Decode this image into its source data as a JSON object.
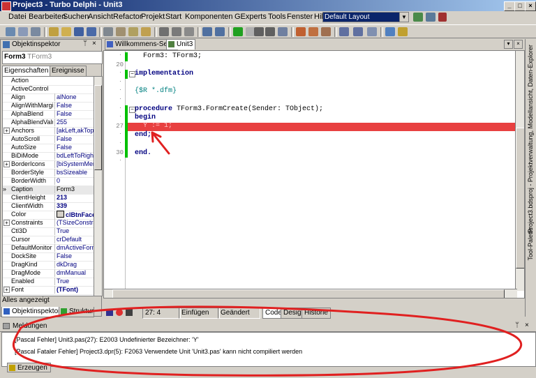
{
  "window": {
    "title": "Project3 - Turbo Delphi - Unit3",
    "buttons": [
      "_",
      "□",
      "×"
    ]
  },
  "menu": [
    "Datei",
    "Bearbeiten",
    "Suchen",
    "Ansicht",
    "Refactor",
    "Projekt",
    "Start",
    "Komponenten",
    "GExperts",
    "Tools",
    "Fenster",
    "Hilfe"
  ],
  "layout_selector": {
    "value": "Default Layout"
  },
  "object_inspector": {
    "title": "Objektinspektor",
    "pin": "ᛘ",
    "close": "×",
    "selected_object": "Form3",
    "selected_type": "TForm3",
    "tabs": [
      "Eigenschaften",
      "Ereignisse"
    ],
    "status": "Alles angezeigt",
    "properties": [
      {
        "name": "Action",
        "value": ""
      },
      {
        "name": "ActiveControl",
        "value": ""
      },
      {
        "name": "Align",
        "value": "alNone"
      },
      {
        "name": "AlignWithMargins",
        "value": "False"
      },
      {
        "name": "AlphaBlend",
        "value": "False"
      },
      {
        "name": "AlphaBlendValue",
        "value": "255"
      },
      {
        "name": "Anchors",
        "value": "[akLeft,akTop]",
        "expand": true
      },
      {
        "name": "AutoScroll",
        "value": "False"
      },
      {
        "name": "AutoSize",
        "value": "False"
      },
      {
        "name": "BiDiMode",
        "value": "bdLeftToRight"
      },
      {
        "name": "BorderIcons",
        "value": "[biSystemMenu",
        "expand": true
      },
      {
        "name": "BorderStyle",
        "value": "bsSizeable"
      },
      {
        "name": "BorderWidth",
        "value": "0"
      },
      {
        "name": "Caption",
        "value": "Form3",
        "selected": true,
        "pointer": "»"
      },
      {
        "name": "ClientHeight",
        "value": "213",
        "bold": true
      },
      {
        "name": "ClientWidth",
        "value": "339",
        "bold": true
      },
      {
        "name": "Color",
        "value": "clBtnFace",
        "bold": true,
        "swatch": true
      },
      {
        "name": "Constraints",
        "value": "(TSizeConstrain",
        "expand": true
      },
      {
        "name": "Ctl3D",
        "value": "True"
      },
      {
        "name": "Cursor",
        "value": "crDefault"
      },
      {
        "name": "DefaultMonitor",
        "value": "dmActiveForm"
      },
      {
        "name": "DockSite",
        "value": "False"
      },
      {
        "name": "DragKind",
        "value": "dkDrag"
      },
      {
        "name": "DragMode",
        "value": "dmManual"
      },
      {
        "name": "Enabled",
        "value": "True"
      },
      {
        "name": "Font",
        "value": "(TFont)",
        "bold": true,
        "expand": true
      }
    ],
    "bottom_tabs": [
      "Objektinspektor",
      "Struktur"
    ]
  },
  "editor": {
    "tabs": [
      "Willkommens-Seite",
      "Unit3"
    ],
    "active_tab": "Unit3",
    "lines": [
      {
        "num": "",
        "text": "  Form3: TForm3;",
        "kind": "plain"
      },
      {
        "num": "20",
        "text": "",
        "kind": "plain"
      },
      {
        "num": "",
        "text": "implementation",
        "kind": "kw"
      },
      {
        "num": "",
        "text": "",
        "kind": "plain"
      },
      {
        "num": "",
        "text": "{$R *.dfm}",
        "kind": "comment"
      },
      {
        "num": "",
        "text": "",
        "kind": "plain"
      },
      {
        "num": "",
        "text": "procedure TForm3.FormCreate(Sender: TObject);",
        "kind": "proc"
      },
      {
        "num": "",
        "text": "begin",
        "kind": "kw"
      },
      {
        "num": "27",
        "text": "  Y := 1;",
        "kind": "error"
      },
      {
        "num": "",
        "text": "end;",
        "kind": "kw"
      },
      {
        "num": "",
        "text": "",
        "kind": "plain"
      },
      {
        "num": "30",
        "text": "end.",
        "kind": "kw"
      },
      {
        "num": "",
        "text": "",
        "kind": "plain"
      }
    ],
    "status": {
      "position": "27:  4",
      "mode": "Einfügen",
      "modified": "Geändert",
      "views": [
        "Code",
        "Design",
        "Historie"
      ]
    }
  },
  "side_panel": {
    "labels": [
      "Project3.bdsproj - Projektverwaltung, Modellansicht, Daten-Explorer",
      "Tool-Palette"
    ]
  },
  "messages": {
    "title": "Meldungen",
    "items": [
      "[Pascal Fehler] Unit3.pas(27): E2003 Undefinierter Bezeichner: 'Y'",
      "[Pascal Fataler Fehler] Project3.dpr(5): F2063 Verwendete Unit 'Unit3.pas' kann nicht compiliert werden"
    ],
    "tab": "Erzeugen"
  },
  "colors": {
    "titlebar": "#0a246a",
    "error_line": "#e84040",
    "annotation": "#e02020",
    "modified_bar": "#00c000"
  }
}
